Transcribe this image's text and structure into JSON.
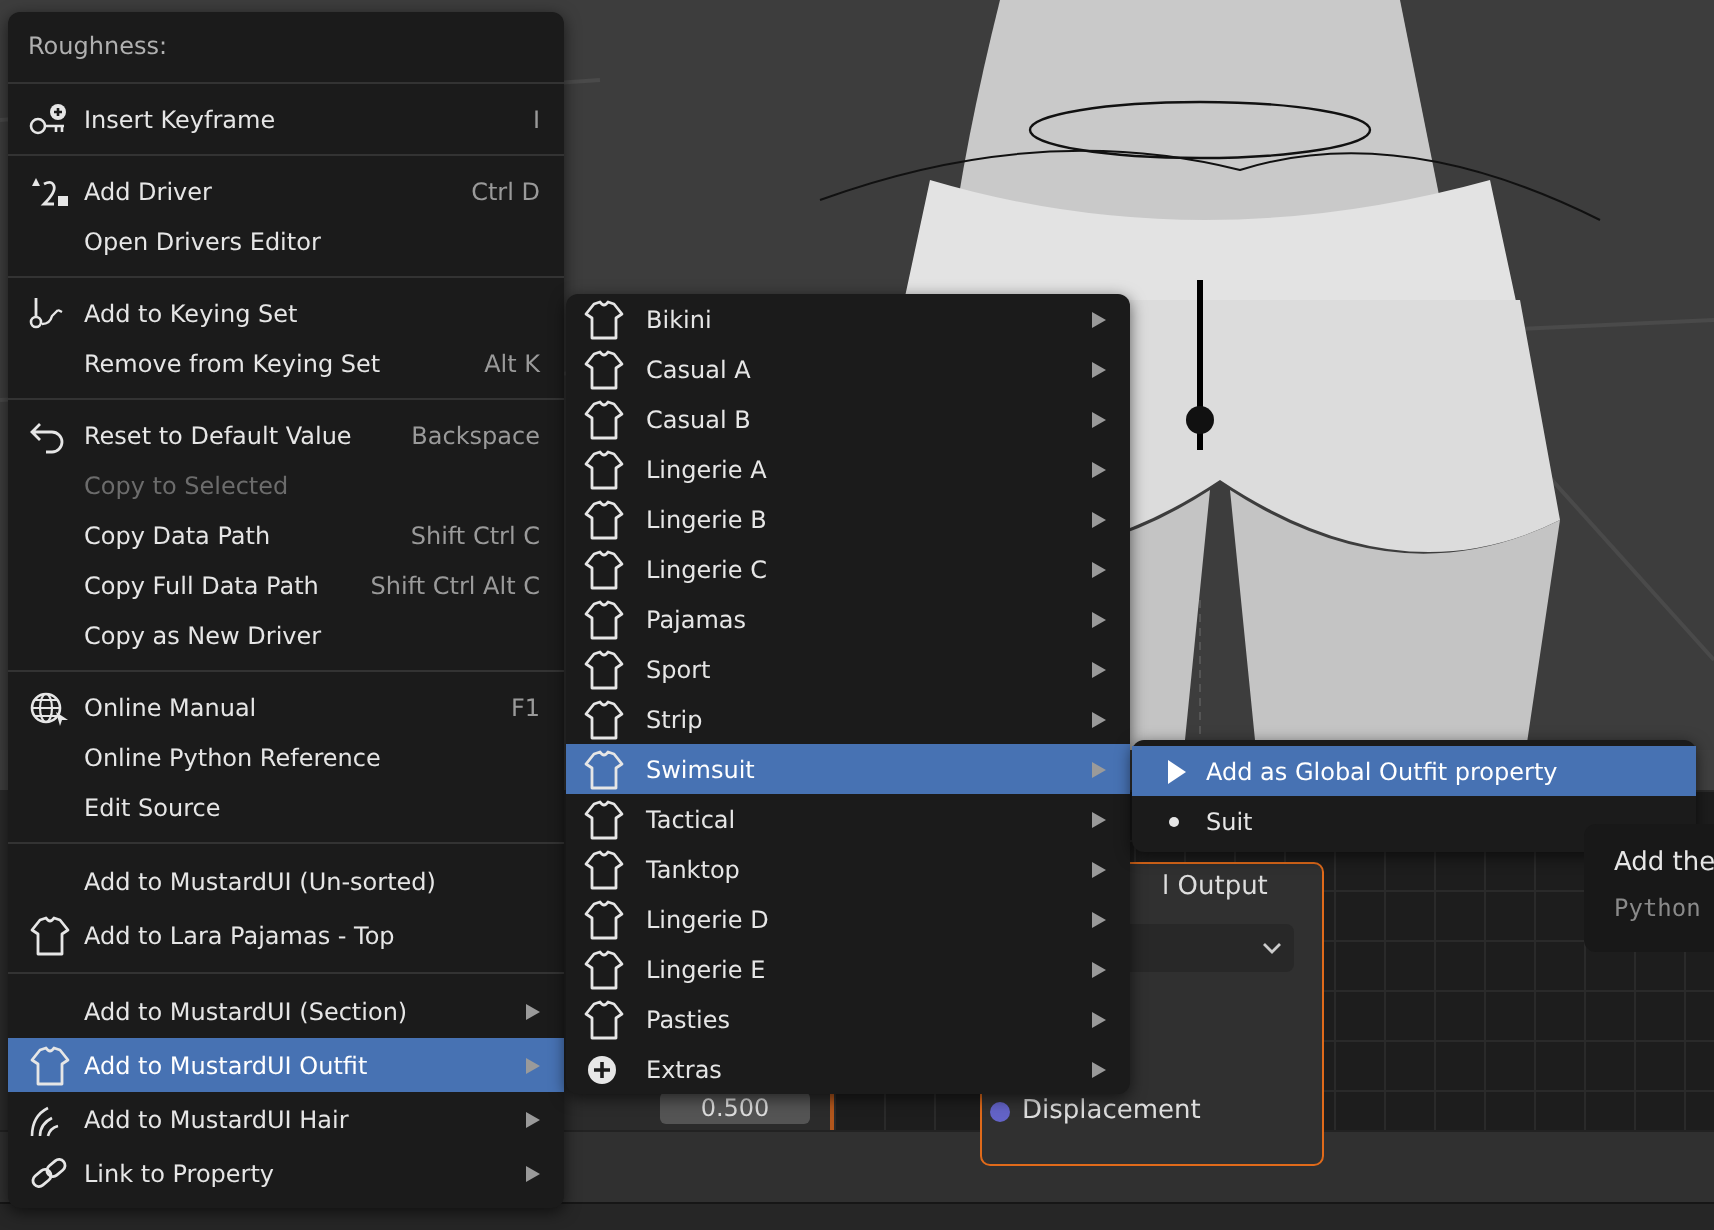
{
  "context_menu": {
    "title": "Roughness:",
    "sections": [
      {
        "items": [
          {
            "label": "Insert Keyframe",
            "shortcut": "I",
            "kind": "keyframe",
            "disabled": false,
            "has_submenu": false,
            "selected": false
          }
        ]
      },
      {
        "items": [
          {
            "label": "Add Driver",
            "shortcut": "Ctrl D",
            "kind": "driver",
            "disabled": false,
            "has_submenu": false,
            "selected": false
          },
          {
            "label": "Open Drivers Editor",
            "kind": "plain",
            "disabled": false,
            "has_submenu": false,
            "selected": false
          }
        ]
      },
      {
        "items": [
          {
            "label": "Add to Keying Set",
            "kind": "keying",
            "disabled": false,
            "has_submenu": false,
            "selected": false
          },
          {
            "label": "Remove from Keying Set",
            "shortcut": "Alt K",
            "kind": "plain",
            "disabled": false,
            "has_submenu": false,
            "selected": false
          }
        ]
      },
      {
        "items": [
          {
            "label": "Reset to Default Value",
            "shortcut": "Backspace",
            "kind": "reset",
            "disabled": false,
            "has_submenu": false,
            "selected": false
          },
          {
            "label": "Copy to Selected",
            "kind": "plain",
            "disabled": true,
            "has_submenu": false,
            "selected": false
          },
          {
            "label": "Copy Data Path",
            "shortcut": "Shift Ctrl C",
            "kind": "plain",
            "disabled": false,
            "has_submenu": false,
            "selected": false
          },
          {
            "label": "Copy Full Data Path",
            "shortcut": "Shift Ctrl Alt C",
            "kind": "plain",
            "disabled": false,
            "has_submenu": false,
            "selected": false
          },
          {
            "label": "Copy as New Driver",
            "kind": "plain",
            "disabled": false,
            "has_submenu": false,
            "selected": false
          }
        ]
      },
      {
        "items": [
          {
            "label": "Online Manual",
            "shortcut": "F1",
            "kind": "globe",
            "disabled": false,
            "has_submenu": false,
            "selected": false
          },
          {
            "label": "Online Python Reference",
            "kind": "plain",
            "disabled": false,
            "has_submenu": false,
            "selected": false
          },
          {
            "label": "Edit Source",
            "kind": "plain",
            "disabled": false,
            "has_submenu": false,
            "selected": false
          }
        ]
      },
      {
        "items": [
          {
            "label": "Add to MustardUI (Un-sorted)",
            "kind": "plain",
            "disabled": false,
            "has_submenu": false,
            "selected": false
          },
          {
            "label": "Add to Lara Pajamas - Top",
            "kind": "shirt",
            "disabled": false,
            "has_submenu": false,
            "selected": false
          }
        ]
      },
      {
        "items": [
          {
            "label": "Add to MustardUI (Section)",
            "kind": "plain",
            "disabled": false,
            "has_submenu": true,
            "selected": false
          },
          {
            "label": "Add to MustardUI Outfit",
            "kind": "shirt",
            "disabled": false,
            "has_submenu": true,
            "selected": true
          },
          {
            "label": "Add to MustardUI Hair",
            "kind": "hair",
            "disabled": false,
            "has_submenu": true,
            "selected": false
          },
          {
            "label": "Link to Property",
            "kind": "link",
            "disabled": false,
            "has_submenu": true,
            "selected": false
          }
        ]
      }
    ]
  },
  "outfit_submenu": {
    "items": [
      {
        "label": "Bikini",
        "kind": "shirt",
        "selected": false
      },
      {
        "label": "Casual A",
        "kind": "shirt",
        "selected": false
      },
      {
        "label": "Casual B",
        "kind": "shirt",
        "selected": false
      },
      {
        "label": "Lingerie A",
        "kind": "shirt",
        "selected": false
      },
      {
        "label": "Lingerie B",
        "kind": "shirt",
        "selected": false
      },
      {
        "label": "Lingerie C",
        "kind": "shirt",
        "selected": false
      },
      {
        "label": "Pajamas",
        "kind": "shirt",
        "selected": false
      },
      {
        "label": "Sport",
        "kind": "shirt",
        "selected": false
      },
      {
        "label": "Strip",
        "kind": "shirt",
        "selected": false
      },
      {
        "label": "Swimsuit",
        "kind": "shirt",
        "selected": true
      },
      {
        "label": "Tactical",
        "kind": "shirt",
        "selected": false
      },
      {
        "label": "Tanktop",
        "kind": "shirt",
        "selected": false
      },
      {
        "label": "Lingerie D",
        "kind": "shirt",
        "selected": false
      },
      {
        "label": "Lingerie E",
        "kind": "shirt",
        "selected": false
      },
      {
        "label": "Pasties",
        "kind": "shirt",
        "selected": false
      },
      {
        "label": "Extras",
        "kind": "plus",
        "selected": false
      }
    ]
  },
  "swimsuit_submenu": {
    "items": [
      {
        "label": "Add as Global Outfit property",
        "kind": "play",
        "selected": true
      },
      {
        "label": "Suit",
        "kind": "dot",
        "selected": false
      }
    ]
  },
  "tooltip": {
    "text": "Add the",
    "python": "Python"
  },
  "properties_panel": {
    "value": "0.500"
  },
  "node": {
    "title": "l Output",
    "socket": "Displacement"
  }
}
